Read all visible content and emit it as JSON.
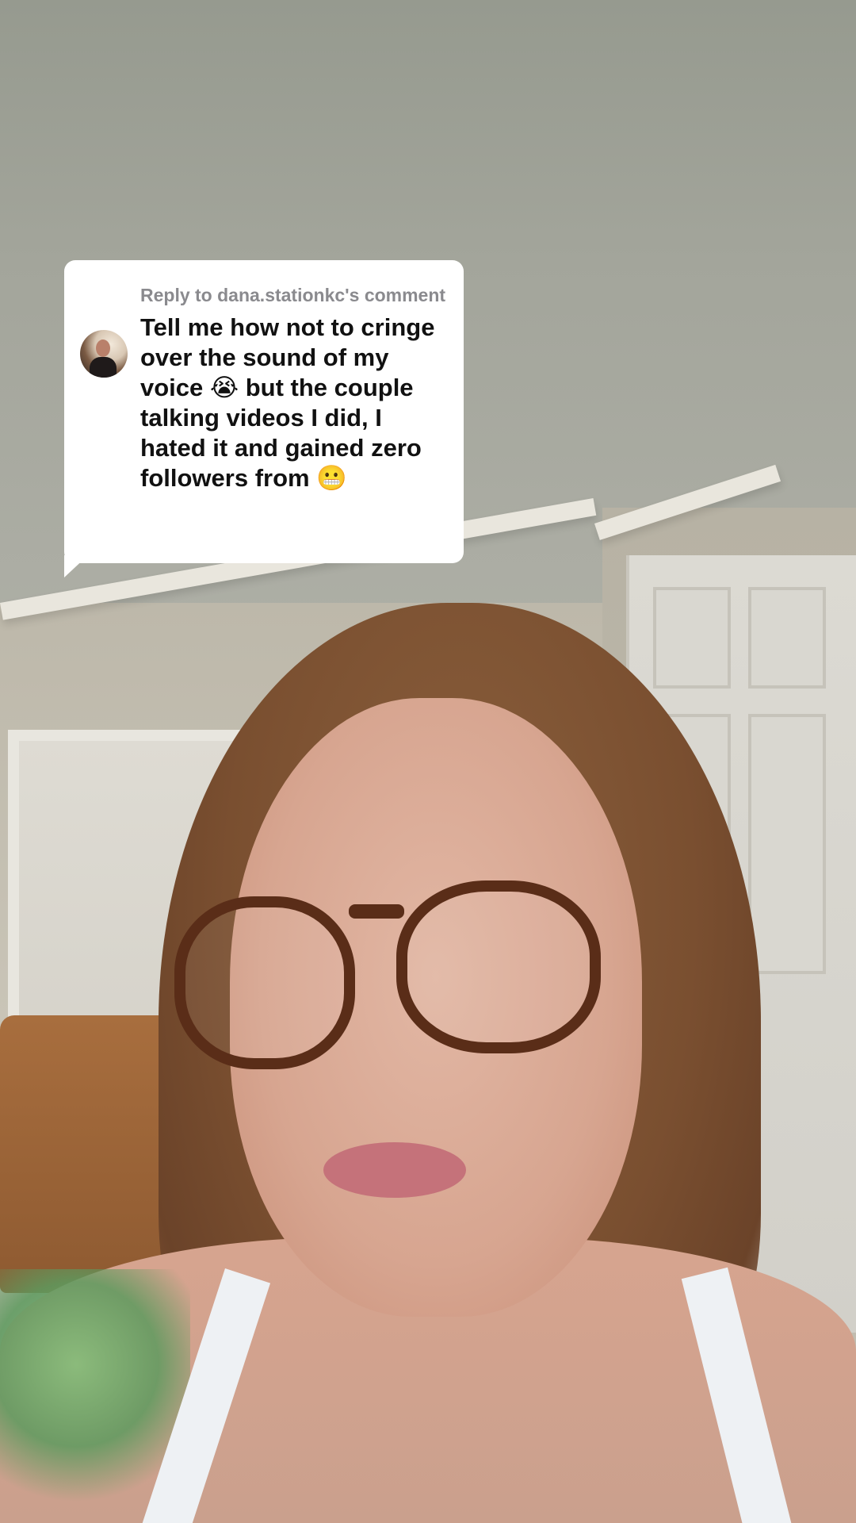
{
  "reply_sticker": {
    "header": "Reply to dana.stationkc's comment",
    "avatar_icon": "user-avatar",
    "comment_text": "Tell me how not to cringe over the sound of my voice 😭 but the couple talking videos I did, I hated it and gained zero followers from 😬"
  },
  "colors": {
    "card_background": "#ffffff",
    "header_text": "#8a8a8e",
    "comment_text": "#111111"
  }
}
